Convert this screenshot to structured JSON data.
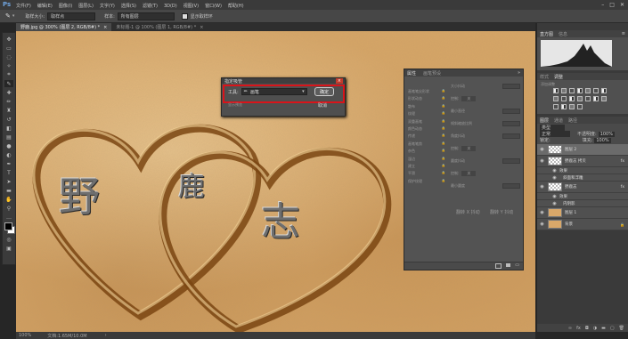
{
  "app": {
    "logo": "Ps"
  },
  "menu": [
    "文件(F)",
    "编辑(E)",
    "图像(I)",
    "图层(L)",
    "文字(Y)",
    "选择(S)",
    "滤镜(T)",
    "3D(D)",
    "视图(V)",
    "窗口(W)",
    "帮助(H)"
  ],
  "options_bar": {
    "sample_size_label": "取样大小:",
    "sample_size_value": "取样点",
    "sample_label": "样本:",
    "sample_value": "所有图层",
    "show_ring_label": "显示取样环"
  },
  "tabs": [
    {
      "label": "野鹿.jpg @ 300% (图层 2, RGB/8#) *",
      "active": true
    },
    {
      "label": "未标题-1 @ 100% (图层 1, RGB/8#) *",
      "active": false
    }
  ],
  "dialog": {
    "title": "指定吸管",
    "tool_label": "工具:",
    "tool_value": "画笔",
    "ok_label": "确定",
    "cancel_label": "取消",
    "extra_label": "显示预览"
  },
  "properties_panel": {
    "tabs": [
      "属性",
      "画笔预设"
    ],
    "list_items": [
      "画笔笔尖形状",
      "形状动态",
      "散布",
      "纹理",
      "双重画笔",
      "颜色动态",
      "传递",
      "画笔笔势",
      "杂色",
      "湿边",
      "建立",
      "平滑",
      "保护纹理"
    ],
    "right_labels": [
      "大小抖动",
      "控制:",
      "最小直径",
      "倾斜缩放比例",
      "角度抖动",
      "控制:",
      "圆度抖动",
      "控制:",
      "最小圆度"
    ],
    "control_value": "关",
    "flip_x": "翻转 X 抖动",
    "flip_y": "翻转 Y 抖动"
  },
  "histogram_panel": {
    "tabs": [
      "直方图",
      "信息"
    ]
  },
  "adjustments_panel": {
    "title": "添加调整",
    "tabs": [
      "样式",
      "调整"
    ]
  },
  "layers_panel": {
    "tabs": [
      "图层",
      "通道",
      "路径"
    ],
    "kind_label": "类型",
    "blend_mode": "正常",
    "opacity_label": "不透明度:",
    "opacity_value": "100%",
    "lock_label": "锁定:",
    "fill_label": "填充:",
    "fill_value": "100%",
    "layers": [
      {
        "name": "图层 2",
        "type": "checker",
        "selected": true
      },
      {
        "name": "野鹿志 拷贝",
        "type": "checker",
        "fx": true
      },
      {
        "name": "效果",
        "type": "sub"
      },
      {
        "name": "斜面和浮雕",
        "type": "subsub"
      },
      {
        "name": "野鹿志",
        "type": "checker",
        "fx": true
      },
      {
        "name": "效果",
        "type": "sub"
      },
      {
        "name": "内阴影",
        "type": "subsub"
      },
      {
        "name": "图层 1",
        "type": "sand"
      },
      {
        "name": "背景",
        "type": "sand",
        "locked": true
      }
    ]
  },
  "canvas": {
    "characters": [
      "野",
      "鹿",
      "志"
    ]
  },
  "status": {
    "zoom": "100%",
    "doc": "文档:1.65M/10.0M"
  },
  "colors": {
    "accent_red": "#d9141a",
    "sand": "#d9a86a"
  }
}
